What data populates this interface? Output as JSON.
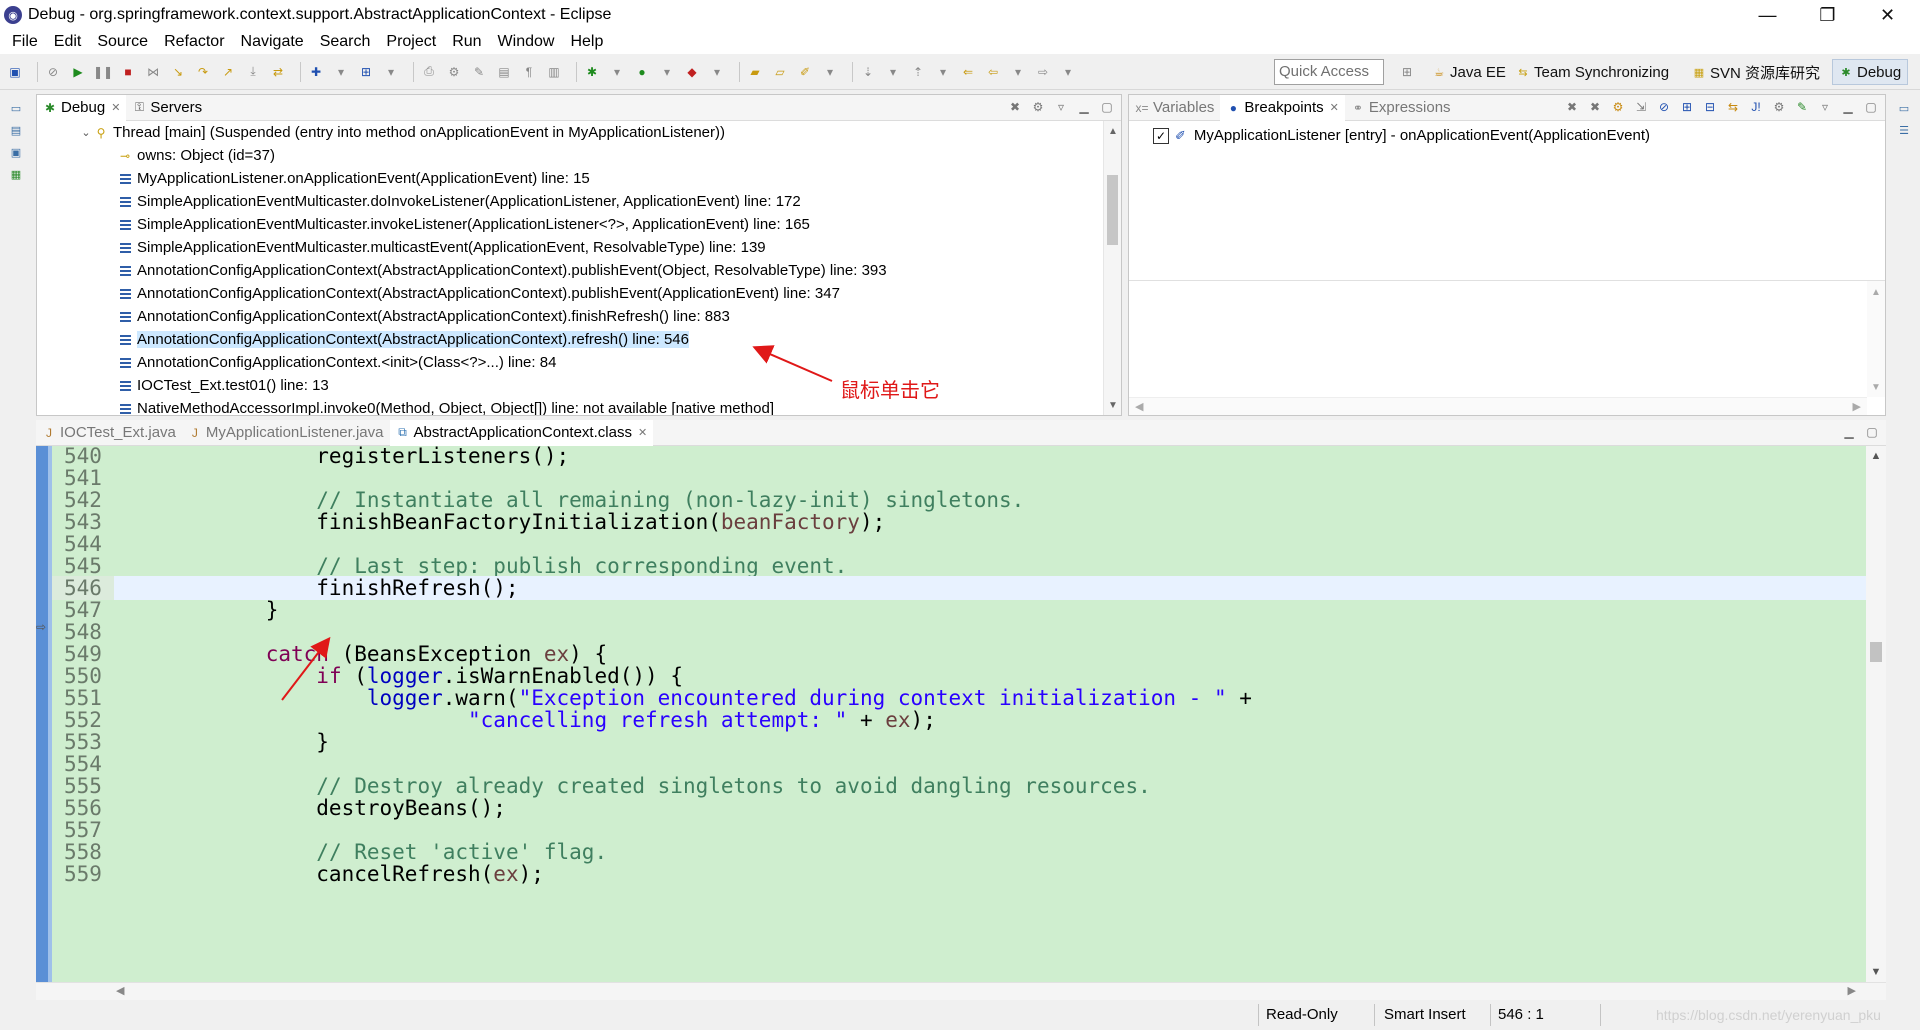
{
  "window": {
    "title": "Debug - org.springframework.context.support.AbstractApplicationContext - Eclipse",
    "controls": [
      "minimize",
      "restore",
      "close"
    ]
  },
  "menu": [
    "File",
    "Edit",
    "Source",
    "Refactor",
    "Navigate",
    "Search",
    "Project",
    "Run",
    "Window",
    "Help"
  ],
  "toolbar": {
    "quick_access": "Quick Access",
    "perspectives": [
      {
        "label": "Java EE",
        "icon": "java-ee-perspective-icon"
      },
      {
        "label": "Team Synchronizing",
        "icon": "team-sync-icon"
      },
      {
        "label": "SVN 资源库研究",
        "icon": "svn-icon"
      },
      {
        "label": "Debug",
        "icon": "debug-perspective-icon",
        "active": true
      }
    ]
  },
  "debug_view": {
    "tabs": [
      {
        "label": "Debug",
        "icon": "debug-bug-icon",
        "active": true
      },
      {
        "label": "Servers",
        "icon": "servers-icon",
        "active": false
      }
    ],
    "thread": "Thread [main] (Suspended (entry into method onApplicationEvent in MyApplicationListener))",
    "owns": "owns: Object  (id=37)",
    "frames": [
      "MyApplicationListener.onApplicationEvent(ApplicationEvent) line: 15",
      "SimpleApplicationEventMulticaster.doInvokeListener(ApplicationListener, ApplicationEvent) line: 172",
      "SimpleApplicationEventMulticaster.invokeListener(ApplicationListener<?>, ApplicationEvent) line: 165",
      "SimpleApplicationEventMulticaster.multicastEvent(ApplicationEvent, ResolvableType) line: 139",
      "AnnotationConfigApplicationContext(AbstractApplicationContext).publishEvent(Object, ResolvableType) line: 393",
      "AnnotationConfigApplicationContext(AbstractApplicationContext).publishEvent(ApplicationEvent) line: 347",
      "AnnotationConfigApplicationContext(AbstractApplicationContext).finishRefresh() line: 883",
      "AnnotationConfigApplicationContext(AbstractApplicationContext).refresh() line: 546",
      "AnnotationConfigApplicationContext.<init>(Class<?>...) line: 84",
      "IOCTest_Ext.test01() line: 13",
      "NativeMethodAccessorImpl.invoke0(Method, Object, Object[]) line: not available [native method]"
    ],
    "selected_frame_index": 7
  },
  "breakpoints_view": {
    "tabs": [
      {
        "label": "Variables",
        "icon": "variables-icon",
        "active": false
      },
      {
        "label": "Breakpoints",
        "icon": "breakpoints-icon",
        "active": true
      },
      {
        "label": "Expressions",
        "icon": "expressions-icon",
        "active": false
      }
    ],
    "items": [
      {
        "label": "MyApplicationListener [entry] - onApplicationEvent(ApplicationEvent)",
        "checked": true
      }
    ]
  },
  "editor": {
    "tabs": [
      {
        "label": "IOCTest_Ext.java",
        "icon": "java-file-icon",
        "active": false
      },
      {
        "label": "MyApplicationListener.java",
        "icon": "java-file-icon",
        "active": false
      },
      {
        "label": "AbstractApplicationContext.class",
        "icon": "class-file-icon",
        "active": true
      }
    ],
    "current_line": "546",
    "lines": [
      {
        "n": "540",
        "html": "                registerListeners();"
      },
      {
        "n": "541",
        "html": ""
      },
      {
        "n": "542",
        "html": "                <span class=\"cm\">// Instantiate all remaining (non-lazy-init) singletons.</span>"
      },
      {
        "n": "543",
        "html": "                finishBeanFactoryInitialization(<span class=\"arg\">beanFactory</span>);"
      },
      {
        "n": "544",
        "html": ""
      },
      {
        "n": "545",
        "html": "                <span class=\"cm\">// Last step: publish corresponding event.</span>"
      },
      {
        "n": "546",
        "html": "                finishRefresh();"
      },
      {
        "n": "547",
        "html": "            }"
      },
      {
        "n": "548",
        "html": ""
      },
      {
        "n": "549",
        "html": "            <span class=\"kw\">catch</span> (BeansException <span class=\"arg\">ex</span>) {"
      },
      {
        "n": "550",
        "html": "                <span class=\"kw\">if</span> (<span class=\"fld\">logger</span>.isWarnEnabled()) {"
      },
      {
        "n": "551",
        "html": "                    <span class=\"fld\">logger</span>.warn(<span class=\"st\">\"Exception encountered during context initialization - \"</span> +"
      },
      {
        "n": "552",
        "html": "                            <span class=\"st\">\"cancelling refresh attempt: \"</span> + <span class=\"arg\">ex</span>);"
      },
      {
        "n": "553",
        "html": "                }"
      },
      {
        "n": "554",
        "html": ""
      },
      {
        "n": "555",
        "html": "                <span class=\"cm\">// Destroy already created singletons to avoid dangling resources.</span>"
      },
      {
        "n": "556",
        "html": "                destroyBeans();"
      },
      {
        "n": "557",
        "html": ""
      },
      {
        "n": "558",
        "html": "                <span class=\"cm\">// Reset 'active' flag.</span>"
      },
      {
        "n": "559",
        "html": "                cancelRefresh(<span class=\"arg\">ex</span>);"
      }
    ]
  },
  "statusbar": {
    "readonly": "Read-Only",
    "insert_mode": "Smart Insert",
    "position": "546 : 1",
    "watermark": "https://blog.csdn.net/yerenyuan_pku"
  },
  "annotation": {
    "text": "鼠标单击它",
    "color": "#e01818"
  },
  "colors": {
    "editor_bg": "#cfeecf",
    "selection": "#cde8ff",
    "keyword": "#7f0055",
    "comment": "#3f7f5f",
    "string": "#2a00ff"
  }
}
